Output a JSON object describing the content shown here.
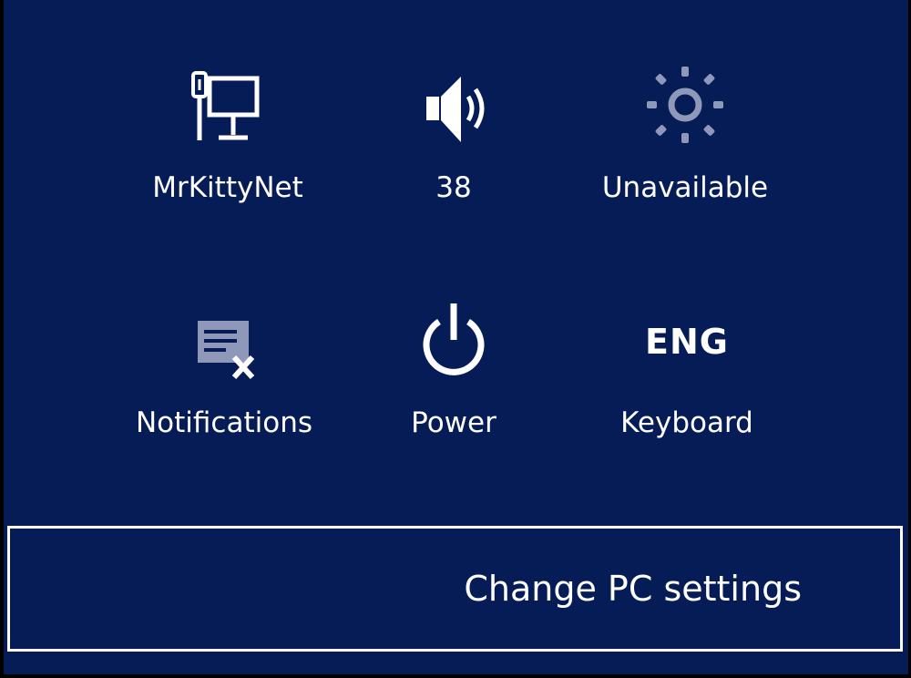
{
  "quick_settings": {
    "network": {
      "label": "MrKittyNet",
      "icon": "wired-network-icon"
    },
    "volume": {
      "label": "38",
      "icon": "speaker-volume-icon"
    },
    "brightness": {
      "label": "Unavailable",
      "icon": "brightness-sun-icon"
    },
    "notifications": {
      "label": "Notifications",
      "icon": "notifications-off-icon"
    },
    "power": {
      "label": "Power",
      "icon": "power-icon"
    },
    "keyboard": {
      "label": "Keyboard",
      "icon_text": "ENG"
    }
  },
  "footer": {
    "change_settings_label": "Change PC settings"
  },
  "colors": {
    "background": "#061c57",
    "foreground": "#ffffff",
    "disabled_icon": "#8f98b8"
  }
}
